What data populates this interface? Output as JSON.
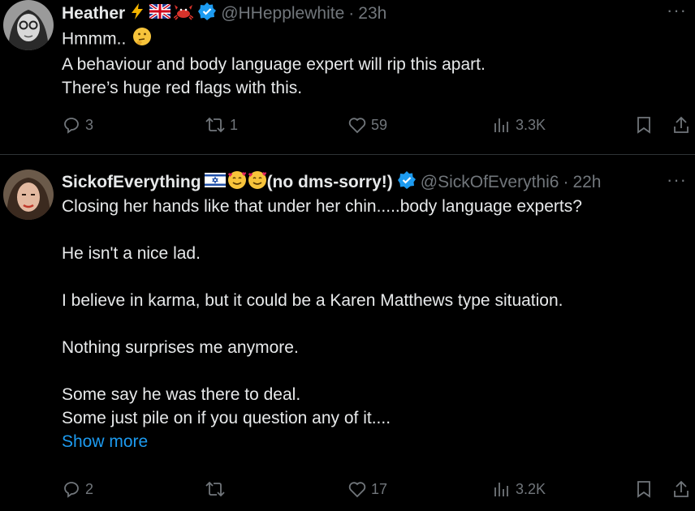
{
  "tweets": [
    {
      "name": "Heather",
      "handle": "@HHepplewhite",
      "time": "23h",
      "badges": [
        "lightning-emoji",
        "uk-flag-emoji",
        "crab-emoji"
      ],
      "text": [
        "Hmmm..",
        "A behaviour and body language expert will rip this apart.",
        "There’s huge red flags with this."
      ],
      "replies": "3",
      "reposts": "1",
      "likes": "59",
      "views": "3.3K",
      "more": "···"
    },
    {
      "name": "SickofEverything",
      "name_suffix": "(no dms-sorry!)",
      "handle": "@SickOfEverythi6",
      "time": "22h",
      "badges": [
        "israel-flag-emoji",
        "smiling-hearts-emoji",
        "smiling-hearts-emoji"
      ],
      "text": [
        "Closing her hands like that under her chin.....body language experts?",
        "He isn't a nice lad.",
        "I believe in karma, but it could be a Karen Matthews type situation.",
        "Nothing surprises me anymore.",
        "Some say he was there to deal.",
        "Some just pile on if you question any of it...."
      ],
      "show_more": "Show more",
      "replies": "2",
      "reposts": "",
      "likes": "17",
      "views": "3.2K",
      "more": "···"
    }
  ],
  "colors": {
    "background": "#000000",
    "text": "#e7e9ea",
    "muted": "#71767b",
    "link": "#1d9bf0",
    "verified": "#1d9bf0"
  }
}
